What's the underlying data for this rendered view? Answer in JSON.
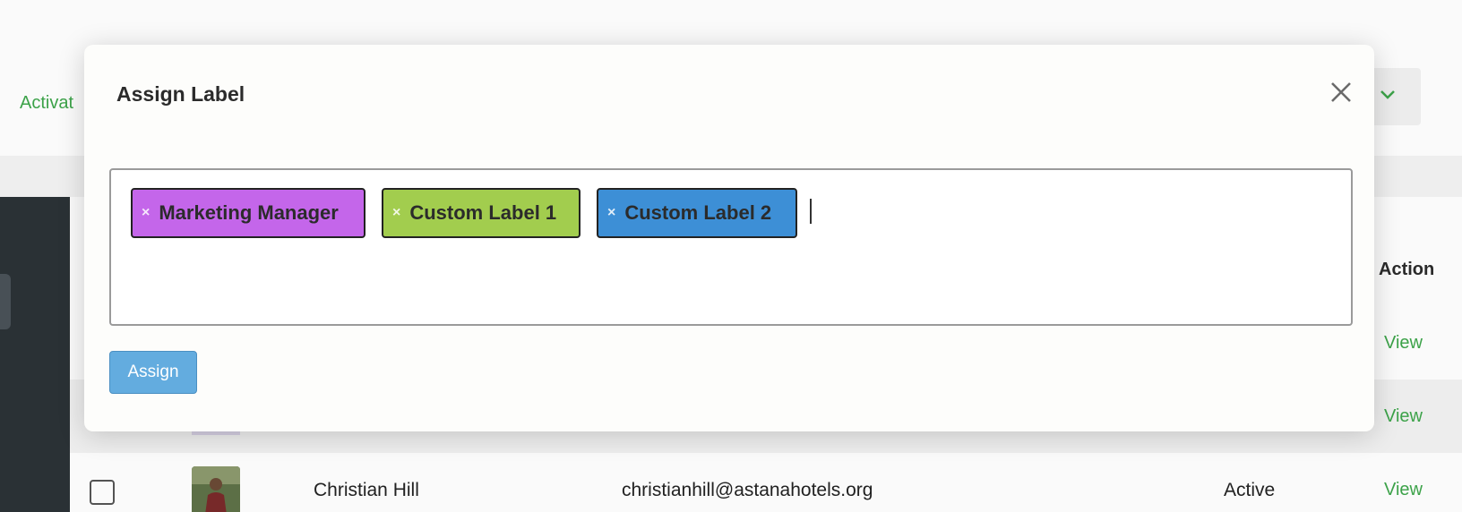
{
  "background": {
    "top_link": "Activat",
    "table": {
      "action_header": "Action",
      "rows": [
        {
          "view_label": "View"
        },
        {
          "view_label": "View"
        },
        {
          "name": "Christian Hill",
          "email": "christianhill@astanahotels.org",
          "status": "Active",
          "view_label": "View"
        }
      ]
    }
  },
  "modal": {
    "title": "Assign Label",
    "tags": [
      {
        "label": "Marketing Manager",
        "remove": "×",
        "color": "#c466ea"
      },
      {
        "label": "Custom Label 1",
        "remove": "×",
        "color": "#a2cd4e"
      },
      {
        "label": "Custom Label 2",
        "remove": "×",
        "color": "#3d8fd6"
      }
    ],
    "assign_label": "Assign",
    "close_icon": "close-icon"
  },
  "colors": {
    "link_green": "#3ea64b",
    "button_blue": "#63acdf",
    "sidebar_dark": "#2b3237"
  }
}
